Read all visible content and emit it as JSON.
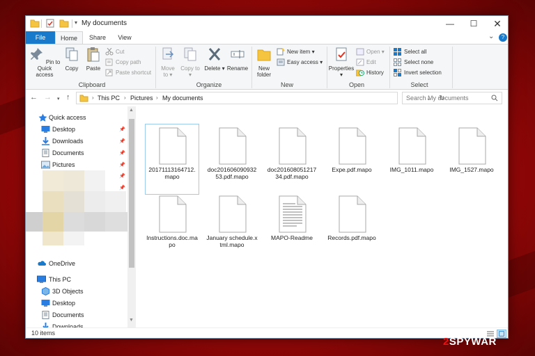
{
  "window": {
    "title": "My documents"
  },
  "ribbon_tabs": [
    "File",
    "Home",
    "Share",
    "View"
  ],
  "ribbon": {
    "clipboard": {
      "pin_to_quick_access": "Pin to Quick access",
      "copy": "Copy",
      "paste": "Paste",
      "cut": "Cut",
      "copy_path": "Copy path",
      "paste_shortcut": "Paste shortcut",
      "label": "Clipboard"
    },
    "organize": {
      "move_to": "Move to",
      "copy_to": "Copy to",
      "delete": "Delete",
      "rename": "Rename",
      "label": "Organize"
    },
    "new": {
      "new_folder": "New folder",
      "new_item": "New item",
      "easy_access": "Easy access",
      "label": "New"
    },
    "open": {
      "properties": "Properties",
      "open": "Open",
      "edit": "Edit",
      "history": "History",
      "label": "Open"
    },
    "select": {
      "select_all": "Select all",
      "select_none": "Select none",
      "invert_selection": "Invert selection",
      "label": "Select"
    }
  },
  "address": {
    "crumbs": [
      "This PC",
      "Pictures",
      "My documents"
    ],
    "search_placeholder": "Search My documents"
  },
  "nav_pane": {
    "quick_access": "Quick access",
    "quick_items": [
      "Desktop",
      "Downloads",
      "Documents",
      "Pictures"
    ],
    "onedrive": "OneDrive",
    "this_pc": "This PC",
    "pc_items": [
      "3D Objects",
      "Desktop",
      "Documents",
      "Downloads"
    ]
  },
  "files": [
    "20171113164712.mapo",
    "doc20160609093253.pdf.mapo",
    "doc20160805121734.pdf.mapo",
    "Expe.pdf.mapo",
    "IMG_1011.mapo",
    "IMG_1527.mapo",
    "Instructions.doc.mapo",
    "January schedule.xtml.mapo",
    "MAPO-Readme",
    "Records.pdf.mapo"
  ],
  "status": {
    "item_count": "10 items"
  },
  "colors": {
    "accent": "#1979ca",
    "folder": "#f5c542",
    "selection": "#cce4f7"
  },
  "watermark": {
    "prefix": "2",
    "text": "SPYWAR"
  }
}
